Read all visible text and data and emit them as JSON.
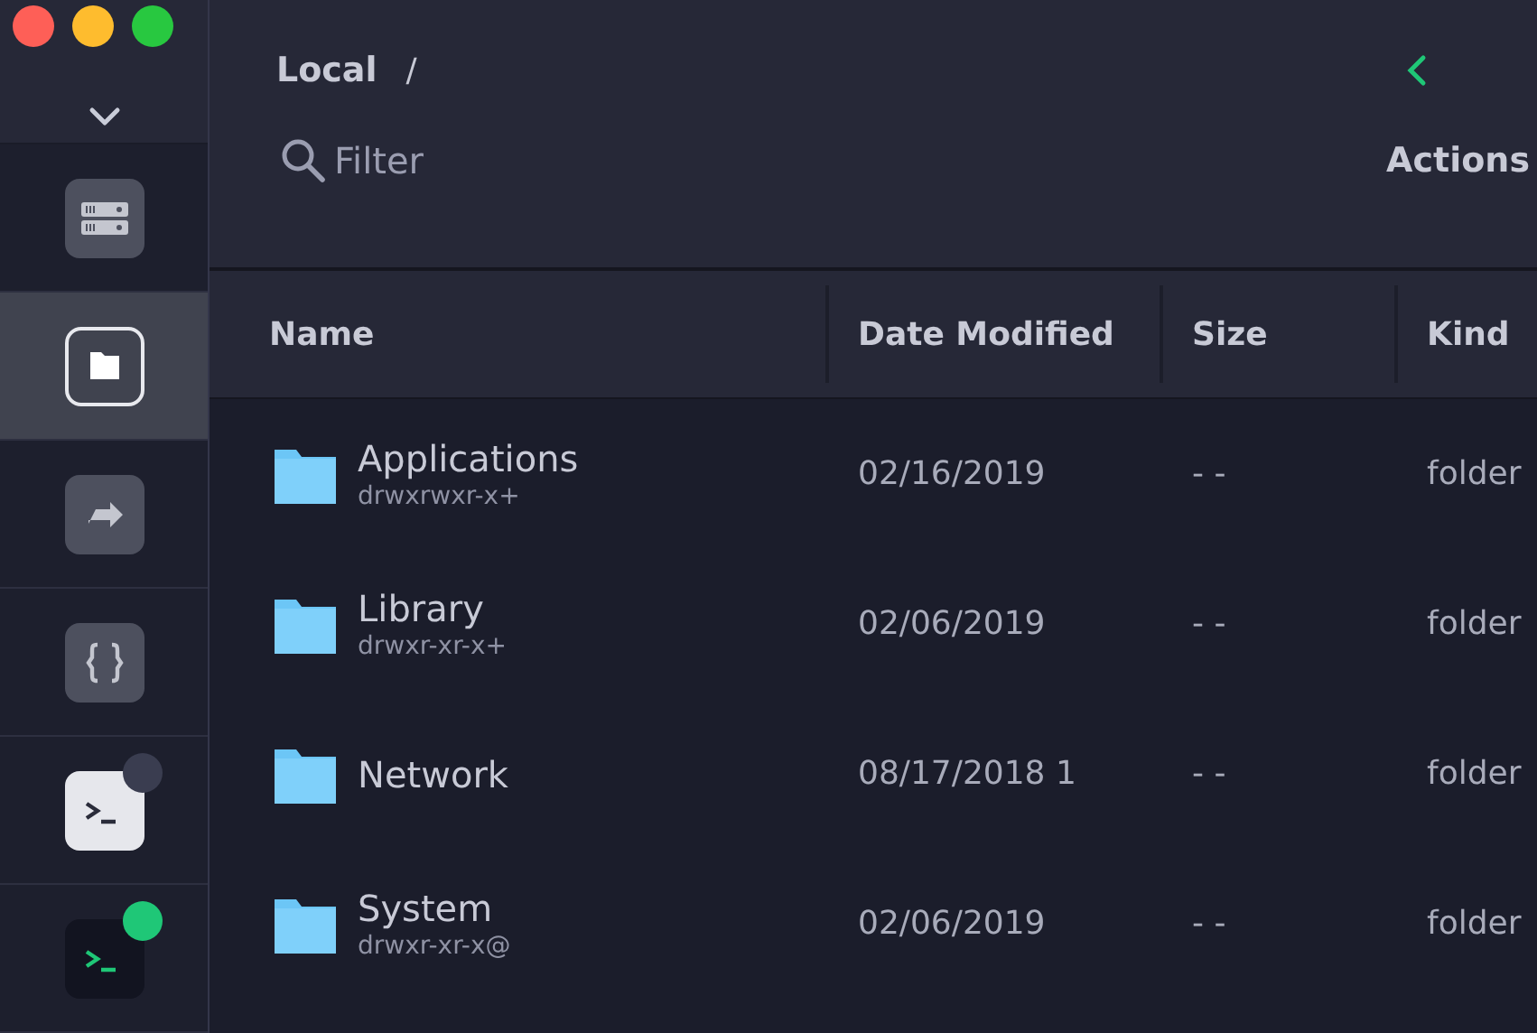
{
  "sidebar": {
    "items": [
      {
        "kind": "hosts",
        "selected": false
      },
      {
        "kind": "sftp",
        "selected": true
      },
      {
        "kind": "forwarding",
        "selected": false
      },
      {
        "kind": "snippets",
        "selected": false
      },
      {
        "kind": "terminal-light",
        "selected": false,
        "color": "#3a3d50"
      },
      {
        "kind": "terminal-dark",
        "selected": false,
        "color": "#1fc777"
      }
    ]
  },
  "breadcrumb": {
    "location": "Local",
    "separator": "/"
  },
  "filter": {
    "placeholder": "Filter"
  },
  "actions": "Actions",
  "table": {
    "columns": [
      "Name",
      "Date Modified",
      "Size",
      "Kind"
    ],
    "rows": [
      {
        "name": "Applications",
        "permissions": "drwxrwxr-x+",
        "date": "02/16/2019",
        "size": "- -",
        "kind": "folder"
      },
      {
        "name": "Library",
        "permissions": "drwxr-xr-x+",
        "date": "02/06/2019",
        "size": "- -",
        "kind": "folder"
      },
      {
        "name": "Network",
        "date": "08/17/2018 1",
        "size": "- -",
        "kind": "folder"
      },
      {
        "name": "System",
        "permissions": "drwxr-xr-x@",
        "date": "02/06/2019",
        "size": "- -",
        "kind": "folder"
      }
    ]
  }
}
